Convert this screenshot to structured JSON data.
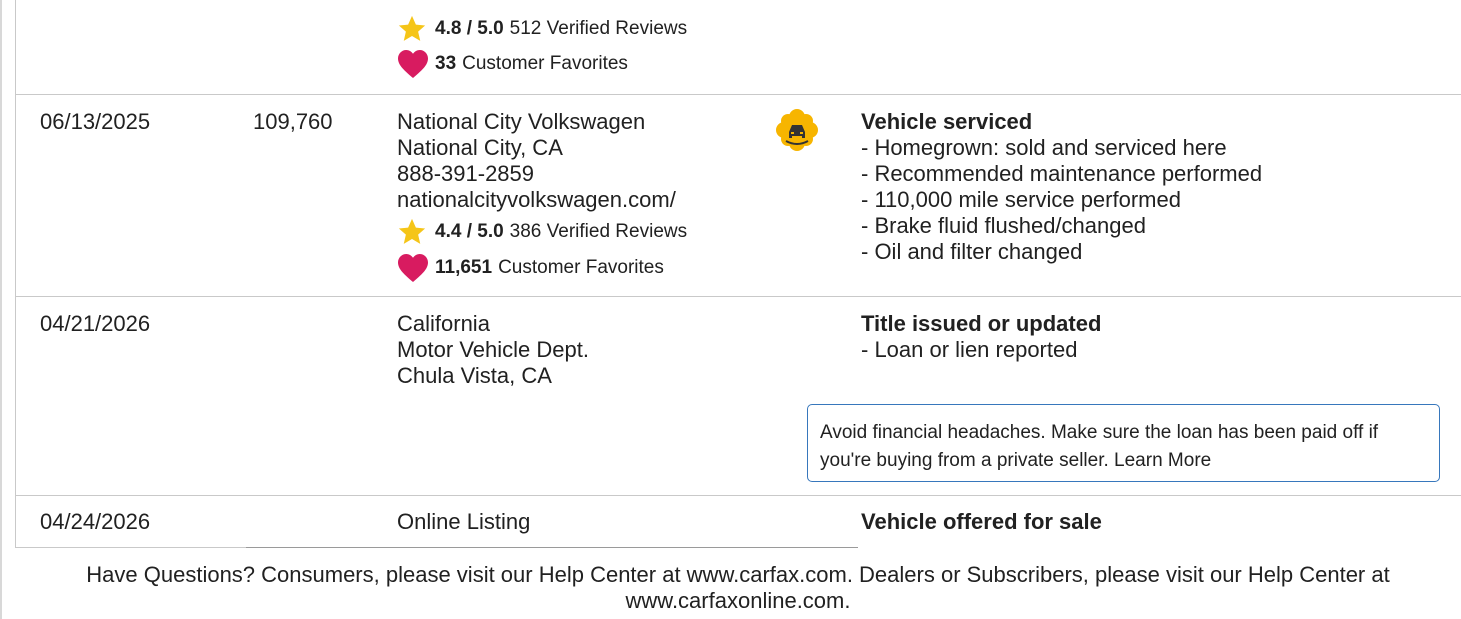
{
  "top_dealer": {
    "rating": "4.8 / 5.0",
    "reviews": "512 Verified Reviews",
    "favorites_count": "33",
    "favorites_label": "Customer Favorites"
  },
  "records": [
    {
      "date": "06/13/2025",
      "odometer": "109,760",
      "source": [
        "National City Volkswagen",
        "National City, CA",
        "888-391-2859",
        "nationalcityvolkswagen.com/"
      ],
      "rating": "4.4 / 5.0",
      "reviews": "386 Verified Reviews",
      "favorites_count": "11,651",
      "favorites_label": "Customer Favorites",
      "icon": "vehicle-service-badge-icon",
      "title": "Vehicle serviced",
      "comments": [
        "- Homegrown: sold and serviced here",
        "- Recommended maintenance performed",
        "- 110,000 mile service performed",
        "- Brake fluid flushed/changed",
        "- Oil and filter changed"
      ]
    },
    {
      "date": "04/21/2026",
      "odometer": "",
      "source": [
        "California",
        "Motor Vehicle Dept.",
        "Chula Vista, CA"
      ],
      "title": "Title issued or updated",
      "comments": [
        "- Loan or lien reported"
      ],
      "callout": "Avoid financial headaches. Make sure the loan has been paid off if you're buying from a private seller. Learn More"
    },
    {
      "date": "04/24/2026",
      "odometer": "",
      "source": [
        "Online Listing"
      ],
      "title": "Vehicle offered for sale"
    }
  ],
  "footer": "Have Questions? Consumers, please visit our Help Center at www.carfax.com. Dealers or Subscribers, please visit our Help Center at www.carfaxonline.com.",
  "colors": {
    "star": "#f5c518",
    "heart": "#d81b60",
    "badge": "#f7b500",
    "callout_border": "#3777bc"
  }
}
